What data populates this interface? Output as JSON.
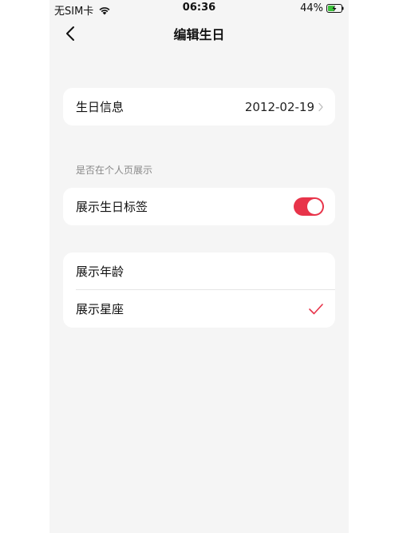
{
  "status_bar": {
    "carrier": "无SIM卡",
    "wifi_icon": "wifi-icon",
    "time": "06:36",
    "battery_percent": "44%",
    "battery_icon": "battery-charging-icon"
  },
  "nav": {
    "back_icon": "chevron-left-icon",
    "title": "编辑生日"
  },
  "birthday_card": {
    "label": "生日信息",
    "value": "2012-02-19"
  },
  "section_caption": "是否在个人页展示",
  "toggle_card": {
    "label": "展示生日标签",
    "enabled": true
  },
  "display_options": {
    "items": [
      {
        "label": "展示年龄",
        "selected": false
      },
      {
        "label": "展示星座",
        "selected": true
      }
    ]
  },
  "colors": {
    "accent": "#e8344a",
    "background": "#f5f5f5",
    "card": "#ffffff"
  }
}
